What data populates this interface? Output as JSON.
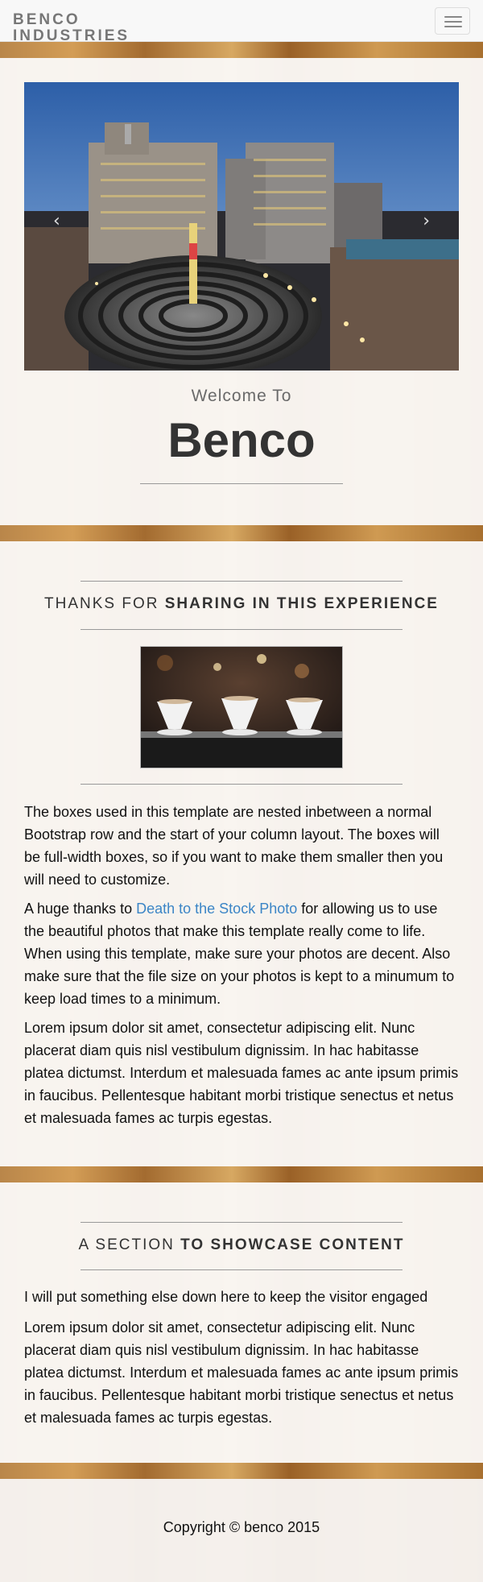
{
  "navbar": {
    "brand": "BENCO INDUSTRIES",
    "toggle_icon": "hamburger-menu-icon"
  },
  "hero": {
    "prev_arrow": "‹",
    "next_arrow": "›",
    "welcome": "Welcome To",
    "title": "Benco"
  },
  "intro_section": {
    "heading_light": "THANKS FOR",
    "heading_bold": "SHARING IN THIS EXPERIENCE",
    "paragraph1": "The boxes used in this template are nested inbetween a normal Bootstrap row and the start of your column layout. The boxes will be full-width boxes, so if you want to make them smaller then you will need to customize.",
    "paragraph2_before": "A huge thanks to ",
    "paragraph2_link": "Death to the Stock Photo",
    "paragraph2_after": " for allowing us to use the beautiful photos that make this template really come to life. When using this template, make sure your photos are decent. Also make sure that the file size on your photos is kept to a minumum to keep load times to a minimum.",
    "paragraph3": "Lorem ipsum dolor sit amet, consectetur adipiscing elit. Nunc placerat diam quis nisl vestibulum dignissim. In hac habitasse platea dictumst. Interdum et malesuada fames ac ante ipsum primis in faucibus. Pellentesque habitant morbi tristique senectus et netus et malesuada fames ac turpis egestas."
  },
  "showcase_section": {
    "heading_light": "A SECTION",
    "heading_bold": "TO SHOWCASE CONTENT",
    "paragraph1": "I will put something else down here to keep the visitor engaged",
    "paragraph2": "Lorem ipsum dolor sit amet, consectetur adipiscing elit. Nunc placerat diam quis nisl vestibulum dignissim. In hac habitasse platea dictumst. Interdum et malesuada fames ac ante ipsum primis in faucibus. Pellentesque habitant morbi tristique senectus et netus et malesuada fames ac turpis egestas."
  },
  "footer": {
    "copyright": "Copyright © benco 2015"
  },
  "colors": {
    "link": "#3b85c6",
    "heading": "#333333",
    "navbar_bg": "#f8f8f8"
  }
}
